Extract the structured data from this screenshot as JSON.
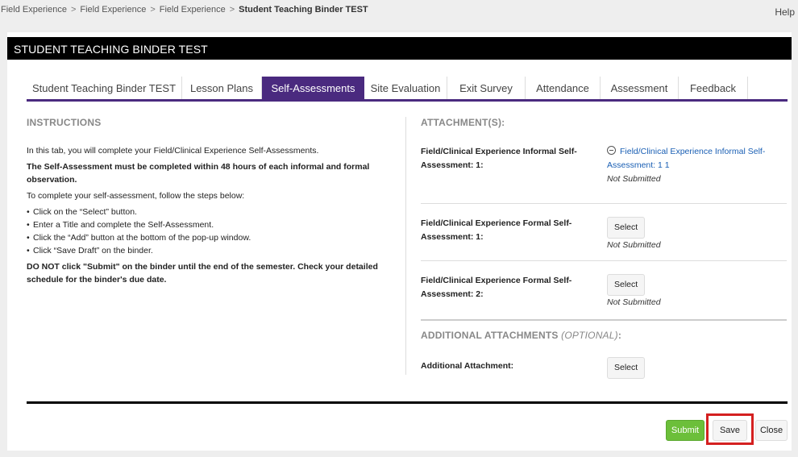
{
  "breadcrumb": {
    "items": [
      "Field Experience",
      "Field Experience",
      "Field Experience"
    ],
    "separator": ">",
    "current": "Student Teaching Binder TEST"
  },
  "help_label": "Help",
  "title": "STUDENT TEACHING BINDER TEST",
  "tabs": [
    {
      "label": "Student Teaching Binder TEST",
      "active": false
    },
    {
      "label": "Lesson Plans",
      "active": false
    },
    {
      "label": "Self-Assessments",
      "active": true
    },
    {
      "label": "Site Evaluation",
      "active": false
    },
    {
      "label": "Exit Survey",
      "active": false
    },
    {
      "label": "Attendance",
      "active": false
    },
    {
      "label": "Assessment",
      "active": false
    },
    {
      "label": "Feedback",
      "active": false
    }
  ],
  "instructions": {
    "heading": "INSTRUCTIONS",
    "intro": "In this tab, you will complete your Field/Clinical Experience Self-Assessments.",
    "deadline": "The Self-Assessment must be completed within 48 hours of each informal and formal observation.",
    "steps_intro": "To complete your self-assessment, follow the steps below:",
    "steps": [
      "Click on the “Select” button.",
      "Enter a Title and complete the Self-Assessment.",
      "Click the “Add” button at the bottom of the pop-up window.",
      "Click “Save Draft” on the binder."
    ],
    "warning": "DO NOT click \"Submit\" on the binder until the end of the semester. Check your detailed schedule for the binder's due date."
  },
  "attachments": {
    "heading": "ATTACHMENT(S):",
    "items": [
      {
        "label": "Field/Clinical Experience Informal Self-Assessment: 1:",
        "link": "Field/Clinical Experience Informal Self-Assessment: 1 1",
        "status": "Not Submitted"
      },
      {
        "label": "Field/Clinical Experience Formal Self-Assessment: 1:",
        "button": "Select",
        "status": "Not Submitted"
      },
      {
        "label": "Field/Clinical Experience Formal Self-Assessment: 2:",
        "button": "Select",
        "status": "Not Submitted"
      }
    ],
    "additional_heading": "ADDITIONAL ATTACHMENTS",
    "additional_optional": "(OPTIONAL)",
    "additional_colon": ":",
    "additional_label": "Additional Attachment:",
    "additional_button": "Select"
  },
  "footer": {
    "submit": "Submit",
    "save": "Save",
    "close": "Close"
  },
  "colors": {
    "tab_active": "#4a2a7f",
    "submit": "#6cbf3a",
    "link": "#1a5fb4",
    "highlight": "#d42020"
  },
  "icons": {
    "remove_attachment": "minus-circle-icon"
  }
}
